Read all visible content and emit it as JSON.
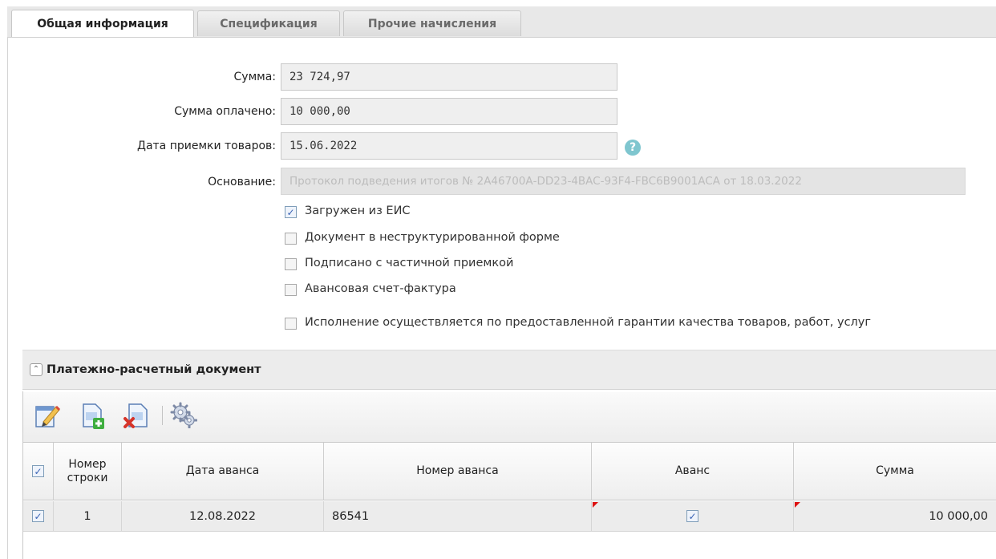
{
  "tabs": [
    {
      "label": "Общая информация",
      "active": true
    },
    {
      "label": "Спецификация",
      "active": false
    },
    {
      "label": "Прочие начисления",
      "active": false
    }
  ],
  "form": {
    "sum": {
      "label": "Сумма:",
      "value": "23 724,97"
    },
    "paid": {
      "label": "Сумма оплачено:",
      "value": "10 000,00"
    },
    "accept_date": {
      "label": "Дата приемки товаров:",
      "value": "15.06.2022"
    },
    "basis": {
      "label": "Основание:",
      "value": "Протокол подведения итогов № 2А46700А-DD23-4BAC-93F4-FBC6B9001ACA от 18.03.2022"
    },
    "help_glyph": "?"
  },
  "checkboxes": [
    {
      "label": "Загружен из ЕИС",
      "checked": true
    },
    {
      "label": "Документ в неструктурированной форме",
      "checked": false
    },
    {
      "label": "Подписано с частичной приемкой",
      "checked": false
    },
    {
      "label": "Авансовая счет-фактура",
      "checked": false
    },
    {
      "label": "Исполнение осуществляется по предоставленной гарантии качества товаров, работ, услуг",
      "checked": false
    }
  ],
  "section": {
    "title": "Платежно-расчетный документ"
  },
  "toolbar": {
    "icons": [
      "edit-icon",
      "add-row-icon",
      "delete-row-icon",
      "settings-icon"
    ]
  },
  "grid": {
    "columns": [
      "Номер строки",
      "Дата аванса",
      "Номер аванса",
      "Аванс",
      "Сумма"
    ],
    "rows": [
      {
        "checked": true,
        "line": "1",
        "date": "12.08.2022",
        "number": "86541",
        "advance": true,
        "sum": "10 000,00"
      }
    ]
  },
  "check_glyph": "✓",
  "colors": {
    "accent": "#7fc6cf",
    "marker": "#d11111",
    "check": "#3a63b5"
  }
}
